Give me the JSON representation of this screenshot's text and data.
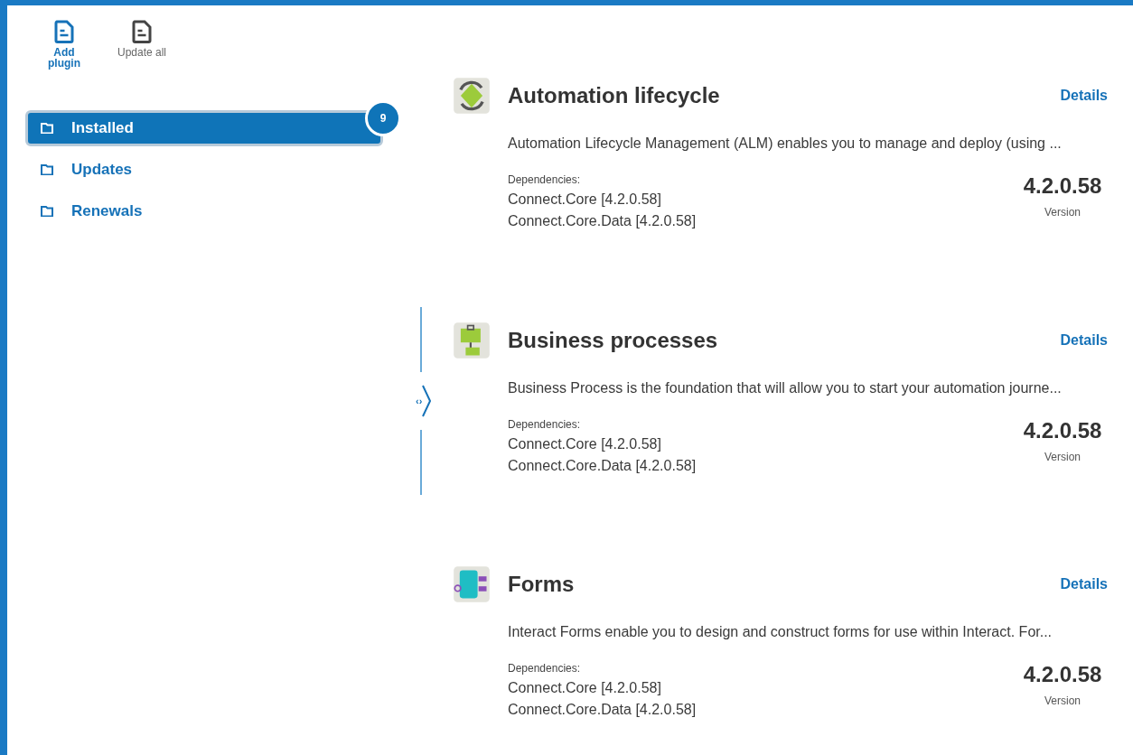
{
  "toolbar": [
    {
      "label": "Add plugin",
      "active": true
    },
    {
      "label": "Update all",
      "active": false
    }
  ],
  "nav": [
    {
      "label": "Installed",
      "selected": true,
      "badge": "9"
    },
    {
      "label": "Updates",
      "selected": false
    },
    {
      "label": "Renewals",
      "selected": false
    }
  ],
  "splitter": {
    "toggle": "‹›"
  },
  "plugins": [
    {
      "kind": "lifecycle",
      "title": "Automation lifecycle",
      "link": "Details",
      "description": "Automation Lifecycle Management (ALM) enables you to manage and deploy (using ...",
      "dependencies_label": "Dependencies:",
      "dependencies": [
        "Connect.Core [4.2.0.58]",
        "Connect.Core.Data [4.2.0.58]"
      ],
      "version": "4.2.0.58",
      "version_label": "Version"
    },
    {
      "kind": "process",
      "title": "Business processes",
      "link": "Details",
      "description": "Business Process is the foundation that will allow you to start your automation journe...",
      "dependencies_label": "Dependencies:",
      "dependencies": [
        "Connect.Core [4.2.0.58]",
        "Connect.Core.Data [4.2.0.58]"
      ],
      "version": "4.2.0.58",
      "version_label": "Version"
    },
    {
      "kind": "forms",
      "title": "Forms",
      "link": "Details",
      "description": "Interact Forms enable you to design and construct forms for use within Interact. For...",
      "dependencies_label": "Dependencies:",
      "dependencies": [
        "Connect.Core [4.2.0.58]",
        "Connect.Core.Data [4.2.0.58]"
      ],
      "version": "4.2.0.58",
      "version_label": "Version"
    }
  ]
}
